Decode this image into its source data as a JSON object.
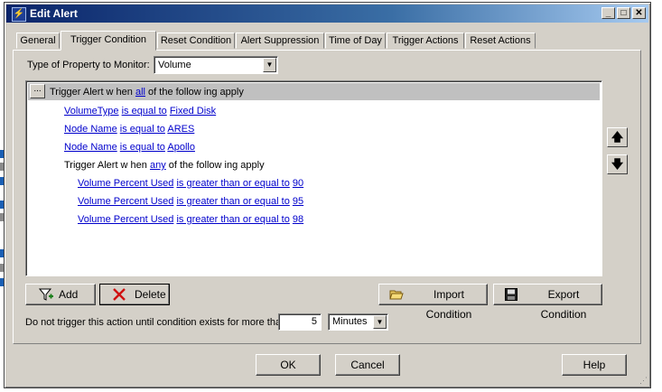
{
  "window": {
    "title": "Edit Alert",
    "icon": "lightning-icon"
  },
  "tabs": [
    {
      "label": "General"
    },
    {
      "label": "Trigger Condition"
    },
    {
      "label": "Reset Condition"
    },
    {
      "label": "Alert Suppression"
    },
    {
      "label": "Time of Day"
    },
    {
      "label": "Trigger Actions"
    },
    {
      "label": "Reset Actions"
    }
  ],
  "property": {
    "label": "Type of Property to Monitor:",
    "value": "Volume"
  },
  "conditions": {
    "header": {
      "dots": "...",
      "prefix": "Trigger Alert w hen ",
      "mode": "all",
      "suffix": " of the follow ing apply"
    },
    "rows": [
      {
        "field": "VolumeType",
        "op": "is equal to",
        "value": "Fixed Disk"
      },
      {
        "field": "Node Name",
        "op": "is equal to",
        "value": "ARES"
      },
      {
        "field": "Node Name",
        "op": "is equal to",
        "value": "Apollo"
      }
    ],
    "subgroup": {
      "prefix": "Trigger Alert w hen ",
      "mode": "any",
      "suffix": " of the follow ing apply"
    },
    "subrows": [
      {
        "field": "Volume Percent Used",
        "op": "is greater than or equal to",
        "value": "90"
      },
      {
        "field": "Volume Percent Used",
        "op": "is greater than or equal to",
        "value": "95"
      },
      {
        "field": "Volume Percent Used",
        "op": "is greater than or equal to",
        "value": "98"
      }
    ]
  },
  "buttons": {
    "add": "Add",
    "delete": "Delete",
    "import": "Import Condition",
    "export": "Export Condition",
    "ok": "OK",
    "cancel": "Cancel",
    "help": "Help"
  },
  "delay": {
    "label": "Do not trigger this action until condition exists for more than",
    "value": "5",
    "unit": "Minutes"
  }
}
